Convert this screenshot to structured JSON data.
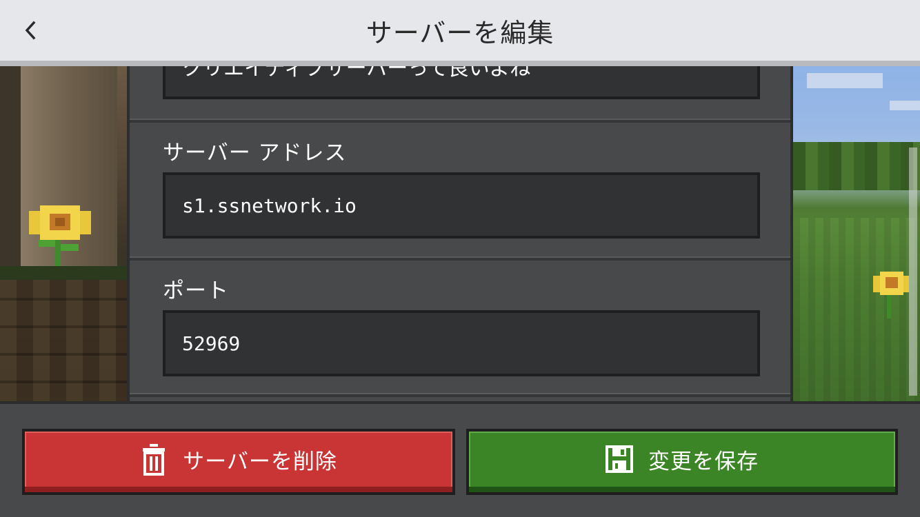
{
  "header": {
    "title": "サーバーを編集",
    "back_icon": "chevron-left-icon"
  },
  "form": {
    "server_name": {
      "value": "クリエイティブサーバーって良いよね"
    },
    "server_address": {
      "label": "サーバー アドレス",
      "value": "s1.ssnetwork.io"
    },
    "port": {
      "label": "ポート",
      "value": "52969"
    }
  },
  "actions": {
    "delete": {
      "label": "サーバーを削除",
      "icon": "trash-icon",
      "color": "#c93434"
    },
    "save": {
      "label": "変更を保存",
      "icon": "save-disk-icon",
      "color": "#3c8527"
    }
  },
  "colors": {
    "topbar_bg": "#e6e7eb",
    "panel_bg": "#48494a",
    "input_bg": "#313233",
    "text": "#ffffff"
  }
}
